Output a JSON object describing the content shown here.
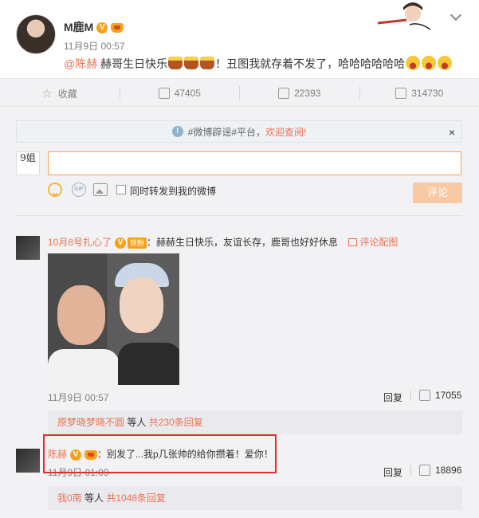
{
  "post": {
    "author": "M鹿M",
    "time": "11月9日 00:57",
    "mention": "@陈赫",
    "text_before_emoji": " 赫哥生日快乐",
    "text_after_emoji": "！丑图我就存着不发了，哈哈哈哈哈哈"
  },
  "actions": {
    "favorite": "收藏",
    "forward": "47405",
    "comment": "22393",
    "like": "314730"
  },
  "notice": {
    "text_plain": "#微博辟谣#平台，",
    "text_highlight": "欢迎查阅!",
    "close": "×"
  },
  "composer": {
    "avatar_text": "9姐",
    "input_value": "",
    "gif_label": "GIF",
    "repost_label": "同时转发到我的微博",
    "submit_label": "评论"
  },
  "comments": [
    {
      "name": "10月8号扎心了",
      "fan_badge": "铁粉",
      "text": "：赫赫生日快乐，友谊长存，鹿哥也好好休息",
      "pic_link": "评论配图",
      "time": "11月9日 00:57",
      "reply": "回复",
      "likes": "17055",
      "sub_user": "原梦晓梦晓不圆",
      "sub_mid": " 等人 ",
      "sub_count": "共230条回复"
    },
    {
      "name": "陈赫",
      "text": "：别发了...我p几张帅的给你攒着！爱你！",
      "time": "11月9日 01:09",
      "reply": "回复",
      "likes": "18896",
      "sub_user": "我0南",
      "sub_mid": " 等人 ",
      "sub_count": "共1048条回复"
    }
  ],
  "colors": {
    "accent": "#eb7350",
    "verified": "#f7a11a",
    "highlight_box": "#e0302a",
    "panel": "#f2f2f5"
  }
}
